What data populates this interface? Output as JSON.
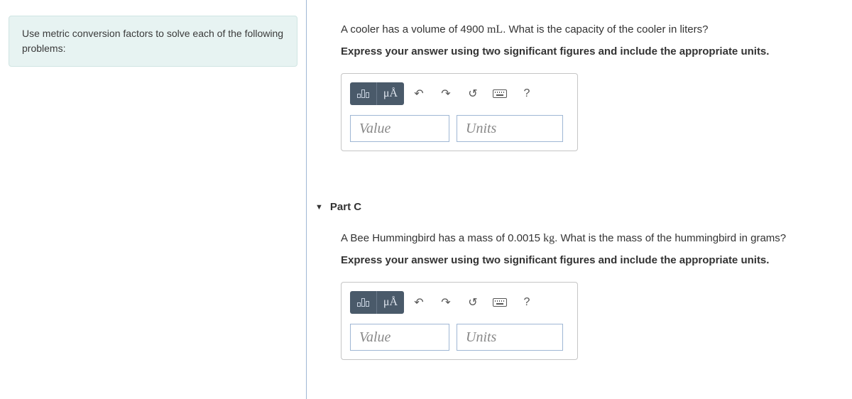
{
  "left": {
    "instruction": "Use metric conversion factors to solve each of the following problems:"
  },
  "partB": {
    "q_prefix": "A cooler has a volume of 4900 ",
    "q_unit": "mL",
    "q_suffix": ". What is the capacity of the cooler in liters?",
    "instruction": "Express your answer using two significant figures and include the appropriate units.",
    "value_ph": "Value",
    "units_ph": "Units",
    "mu_label": "μÅ",
    "help_label": "?"
  },
  "partC": {
    "title": "Part C",
    "q_prefix": "A Bee Hummingbird has a mass of 0.0015 ",
    "q_unit": "kg",
    "q_suffix": ". What is the mass of the hummingbird in grams?",
    "instruction": "Express your answer using two significant figures and include the appropriate units.",
    "value_ph": "Value",
    "units_ph": "Units",
    "mu_label": "μÅ",
    "help_label": "?"
  }
}
